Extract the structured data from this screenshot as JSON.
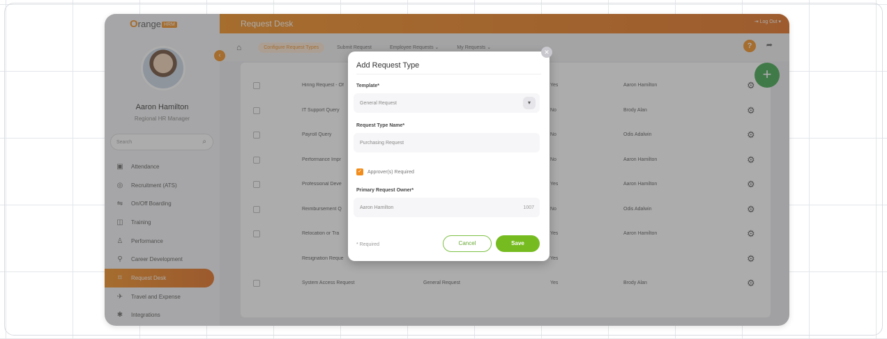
{
  "app": {
    "logo_text": "range",
    "logo_o": "O",
    "logo_hrm": "HRM",
    "brand_color": "#f28c1b",
    "accent_green": "#76bc21"
  },
  "sidebar": {
    "user_name": "Aaron Hamilton",
    "user_role": "Regional HR Manager",
    "search_placeholder": "Search",
    "items": [
      {
        "label": "Attendance",
        "icon": "attendance-icon"
      },
      {
        "label": "Recruitment (ATS)",
        "icon": "recruitment-icon"
      },
      {
        "label": "On/Off Boarding",
        "icon": "onboarding-icon"
      },
      {
        "label": "Training",
        "icon": "training-icon"
      },
      {
        "label": "Performance",
        "icon": "performance-icon"
      },
      {
        "label": "Career Development",
        "icon": "career-icon"
      },
      {
        "label": "Request Desk",
        "icon": "request-desk-icon",
        "active": true
      },
      {
        "label": "Travel and Expense",
        "icon": "travel-icon"
      },
      {
        "label": "Integrations",
        "icon": "integrations-icon"
      }
    ]
  },
  "topbar": {
    "title": "Request Desk",
    "logout": "Log Out"
  },
  "subnav": {
    "tabs": [
      "Configure Request Types",
      "Submit Request",
      "Employee Requests",
      "My Requests"
    ]
  },
  "table": {
    "rows": [
      {
        "name": "Hiring Request - Of",
        "template": "",
        "approval": "Yes",
        "owner": "Aaron Hamilton",
        "checkbox": true
      },
      {
        "name": "IT Support Query",
        "template": "",
        "approval": "No",
        "owner": "Brody Alan",
        "checkbox": true
      },
      {
        "name": "Payroll Query",
        "template": "",
        "approval": "No",
        "owner": "Odis Adalwin",
        "checkbox": true
      },
      {
        "name": "Performance Impr",
        "template": "",
        "approval": "No",
        "owner": "Aaron Hamilton",
        "checkbox": true
      },
      {
        "name": "Professional Deve",
        "template": "",
        "approval": "Yes",
        "owner": "Aaron Hamilton",
        "checkbox": true
      },
      {
        "name": "Reimbursement Q",
        "template": "",
        "approval": "No",
        "owner": "Odis Adalwin",
        "checkbox": true
      },
      {
        "name": "Relocation or Tra",
        "template": "",
        "approval": "Yes",
        "owner": "Aaron Hamilton",
        "checkbox": true
      },
      {
        "name": "Resignation Reque",
        "template": "",
        "approval": "Yes",
        "owner": "",
        "checkbox": false
      },
      {
        "name": "System Access Request",
        "template": "General Request",
        "approval": "Yes",
        "owner": "Brody Alan",
        "checkbox": true
      }
    ]
  },
  "modal": {
    "title": "Add Request Type",
    "template_label": "Template*",
    "template_value": "General Request",
    "name_label": "Request Type Name*",
    "name_value": "Purchasing Request",
    "approver_label": "Approver(s) Required",
    "approver_checked": true,
    "owner_label": "Primary Request Owner*",
    "owner_value": "Aaron Hamilton",
    "owner_id": "1007",
    "required_note": "* Required",
    "cancel": "Cancel",
    "save": "Save"
  }
}
